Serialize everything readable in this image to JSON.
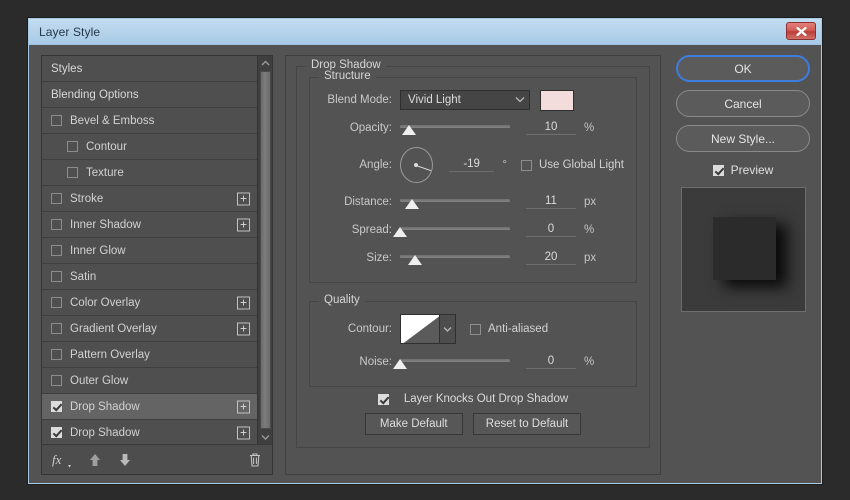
{
  "window": {
    "title": "Layer Style",
    "close_icon": "close-icon",
    "titlebar_color": "#b4d2ea",
    "border_color": "#a9cbe8",
    "background_color": "#535353"
  },
  "styles_panel": {
    "items": [
      {
        "label": "Styles",
        "type": "header",
        "checked": null,
        "indent": 0,
        "plus": false,
        "selected": false
      },
      {
        "label": "Blending Options",
        "type": "header",
        "checked": null,
        "indent": 0,
        "plus": false,
        "selected": false
      },
      {
        "label": "Bevel & Emboss",
        "type": "effect",
        "checked": false,
        "indent": 0,
        "plus": false,
        "selected": false
      },
      {
        "label": "Contour",
        "type": "sub",
        "checked": false,
        "indent": 1,
        "plus": false,
        "selected": false
      },
      {
        "label": "Texture",
        "type": "sub",
        "checked": false,
        "indent": 1,
        "plus": false,
        "selected": false
      },
      {
        "label": "Stroke",
        "type": "effect",
        "checked": false,
        "indent": 0,
        "plus": true,
        "selected": false
      },
      {
        "label": "Inner Shadow",
        "type": "effect",
        "checked": false,
        "indent": 0,
        "plus": true,
        "selected": false
      },
      {
        "label": "Inner Glow",
        "type": "effect",
        "checked": false,
        "indent": 0,
        "plus": false,
        "selected": false
      },
      {
        "label": "Satin",
        "type": "effect",
        "checked": false,
        "indent": 0,
        "plus": false,
        "selected": false
      },
      {
        "label": "Color Overlay",
        "type": "effect",
        "checked": false,
        "indent": 0,
        "plus": true,
        "selected": false
      },
      {
        "label": "Gradient Overlay",
        "type": "effect",
        "checked": false,
        "indent": 0,
        "plus": true,
        "selected": false
      },
      {
        "label": "Pattern Overlay",
        "type": "effect",
        "checked": false,
        "indent": 0,
        "plus": false,
        "selected": false
      },
      {
        "label": "Outer Glow",
        "type": "effect",
        "checked": false,
        "indent": 0,
        "plus": false,
        "selected": false
      },
      {
        "label": "Drop Shadow",
        "type": "effect",
        "checked": true,
        "indent": 0,
        "plus": true,
        "selected": true
      },
      {
        "label": "Drop Shadow",
        "type": "effect",
        "checked": true,
        "indent": 0,
        "plus": true,
        "selected": false
      }
    ],
    "toolbar": {
      "fx_icon": "fx-icon",
      "fx_label": "fx",
      "move_up_icon": "arrow-up-icon",
      "move_down_icon": "arrow-down-icon",
      "delete_icon": "trash-icon"
    },
    "scrollbar": {
      "up_icon": "chevron-up-icon",
      "down_icon": "chevron-down-icon"
    }
  },
  "settings": {
    "panel_title": "Drop Shadow",
    "structure": {
      "title": "Structure",
      "blend_mode": {
        "label": "Blend Mode:",
        "value": "Vivid Light",
        "chevron_icon": "chevron-down-icon"
      },
      "color": {
        "swatch_color": "#f2dcdc"
      },
      "opacity": {
        "label": "Opacity:",
        "value": "10",
        "unit": "%",
        "slider_pct": 8
      },
      "angle": {
        "label": "Angle:",
        "value": "-19",
        "unit": "°",
        "degrees": -19
      },
      "use_global_light": {
        "label": "Use Global Light",
        "checked": false
      },
      "distance": {
        "label": "Distance:",
        "value": "11",
        "unit": "px",
        "slider_pct": 11
      },
      "spread": {
        "label": "Spread:",
        "value": "0",
        "unit": "%",
        "slider_pct": 0
      },
      "size": {
        "label": "Size:",
        "value": "20",
        "unit": "px",
        "slider_pct": 14
      }
    },
    "quality": {
      "title": "Quality",
      "contour": {
        "label": "Contour:",
        "chevron_icon": "chevron-down-icon"
      },
      "anti_aliased": {
        "label": "Anti-aliased",
        "checked": false
      },
      "noise": {
        "label": "Noise:",
        "value": "0",
        "unit": "%",
        "slider_pct": 0
      }
    },
    "knockout": {
      "label": "Layer Knocks Out Drop Shadow",
      "checked": true
    },
    "make_default_label": "Make Default",
    "reset_default_label": "Reset to Default"
  },
  "actions": {
    "ok_label": "OK",
    "cancel_label": "Cancel",
    "new_style_label": "New Style...",
    "preview_label": "Preview",
    "preview_checked": true,
    "focus_color": "#3c7ddd"
  }
}
